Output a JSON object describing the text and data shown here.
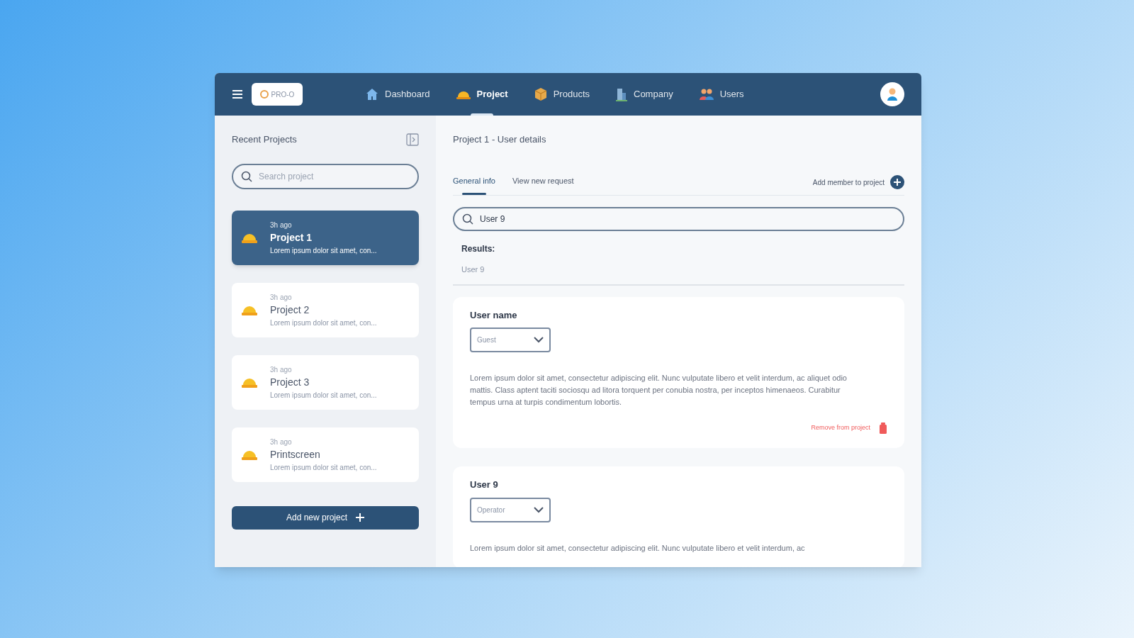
{
  "header": {
    "logo": "PRO-O",
    "nav": [
      {
        "label": "Dashboard",
        "kind": "house",
        "selected": false
      },
      {
        "label": "Project",
        "kind": "helmet",
        "selected": true
      },
      {
        "label": "Products",
        "kind": "box",
        "selected": false
      },
      {
        "label": "Company",
        "kind": "building",
        "selected": false
      },
      {
        "label": "Users",
        "kind": "users",
        "selected": false
      }
    ]
  },
  "sidebar": {
    "title": "Recent Projects",
    "search": {
      "placeholder": "Search project"
    },
    "projects": [
      {
        "time": "3h ago",
        "name": "Project 1",
        "description": "Lorem ipsum dolor sit amet, con...",
        "selected": true
      },
      {
        "time": "3h ago",
        "name": "Project 2",
        "description": "Lorem ipsum dolor sit amet, con...",
        "selected": false
      },
      {
        "time": "3h ago",
        "name": "Project 3",
        "description": "Lorem ipsum dolor sit amet, con...",
        "selected": false
      },
      {
        "time": "3h ago",
        "name": "Printscreen",
        "description": "Lorem ipsum dolor sit amet, con...",
        "selected": false
      }
    ],
    "add_button": "Add new project"
  },
  "main": {
    "title": "Project 1 - User details",
    "tabs": [
      {
        "label": "General info",
        "selected": true
      },
      {
        "label": "View new request",
        "selected": false
      }
    ],
    "add_member": "Add member to project",
    "search": {
      "value": "User 9"
    },
    "results_label": "Results:",
    "results": [
      "User 9"
    ],
    "users": [
      {
        "name": "User name",
        "role": "Guest",
        "text": "Lorem ipsum dolor sit amet, consectetur adipiscing elit. Nunc vulputate libero et velit interdum, ac aliquet odio mattis. Class aptent taciti sociosqu ad litora torquent per conubia nostra, per inceptos himenaeos. Curabitur tempus urna at turpis condimentum lobortis.",
        "remove": "Remove from project"
      },
      {
        "name": "User 9",
        "role": "Operator",
        "text": "Lorem ipsum dolor sit amet, consectetur adipiscing elit. Nunc vulputate libero et velit interdum, ac"
      }
    ]
  }
}
